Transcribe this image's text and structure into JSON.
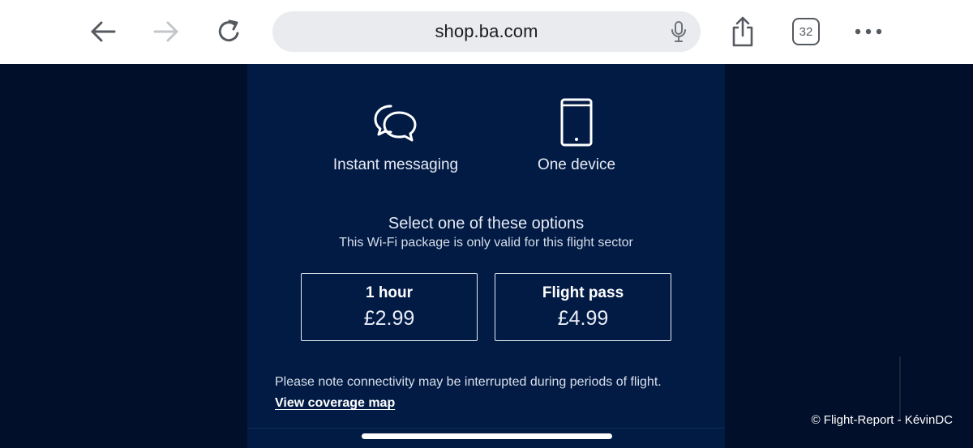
{
  "browser": {
    "url": "shop.ba.com",
    "tab_count": "32",
    "icons": {
      "back": "arrow-left-icon",
      "forward": "arrow-right-icon",
      "reload": "reload-icon",
      "mic": "microphone-icon",
      "share": "share-icon",
      "tabs": "tabs-icon",
      "more": "more-dots-icon"
    }
  },
  "features": [
    {
      "label": "Instant messaging",
      "icon": "chat-bubbles-icon"
    },
    {
      "label": "One device",
      "icon": "smartphone-icon"
    }
  ],
  "selection": {
    "title": "Select one of these options",
    "subtitle": "This Wi-Fi package is only valid for this flight sector"
  },
  "options": [
    {
      "name": "1 hour",
      "price": "£2.99"
    },
    {
      "name": "Flight pass",
      "price": "£4.99"
    }
  ],
  "note": "Please note connectivity may be interrupted during periods of flight.",
  "coverage_link": "View coverage map",
  "watermark": "© Flight-Report - KévinDC",
  "colors": {
    "page_bg": "#020f2a",
    "panel_bg": "#021b45",
    "toolbar_bg": "#ffffff",
    "address_bg": "#e9ebee"
  }
}
